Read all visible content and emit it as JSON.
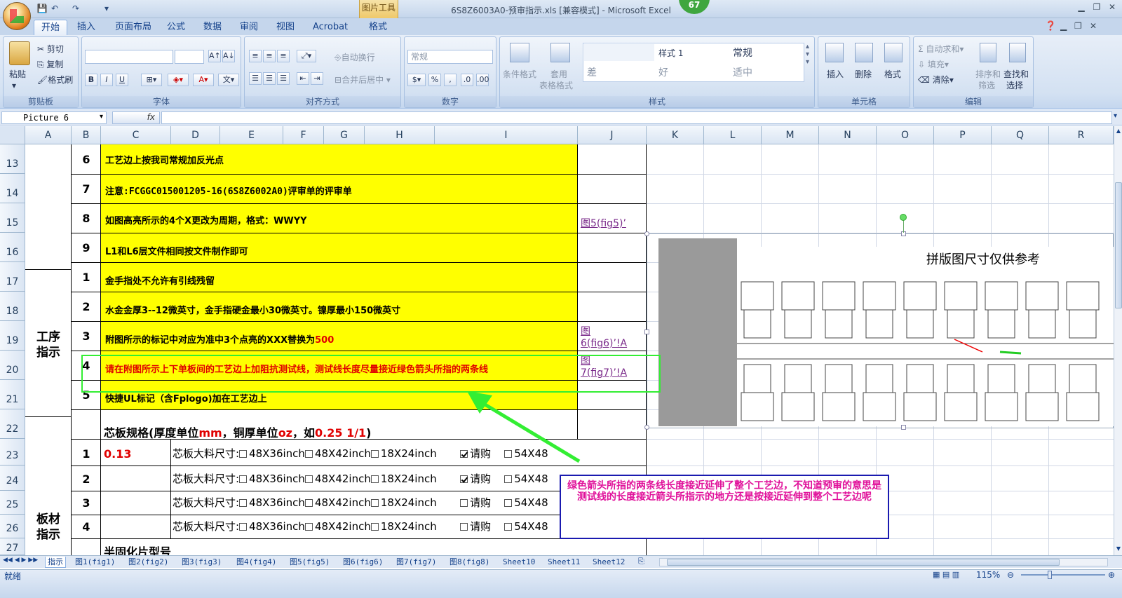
{
  "window": {
    "title": "6S8Z6003A0-预审指示.xls  [兼容模式] - Microsoft Excel",
    "context_tab": "图片工具",
    "badge": "67"
  },
  "tabs": [
    "开始",
    "插入",
    "页面布局",
    "公式",
    "数据",
    "审阅",
    "视图",
    "Acrobat",
    "格式"
  ],
  "ribbon": {
    "clipboard": {
      "label": "剪贴板",
      "paste": "粘贴",
      "cut": "剪切",
      "copy": "复制",
      "format_painter": "格式刷"
    },
    "font": {
      "label": "字体",
      "bold": "B",
      "italic": "I",
      "underline": "U"
    },
    "alignment": {
      "label": "对齐方式",
      "wrap": "自动换行",
      "merge": "合并后居中"
    },
    "number": {
      "label": "数字",
      "format": "常规",
      "percent": "%"
    },
    "styles": {
      "label": "样式",
      "conditional": "条件格式",
      "table_format_1": "套用",
      "table_format_2": "表格格式",
      "style1": "样式 1",
      "normal": "常规",
      "bad": "差",
      "good": "好",
      "neutral": "适中"
    },
    "cells": {
      "label": "单元格",
      "insert": "插入",
      "delete": "删除",
      "format": "格式"
    },
    "editing": {
      "label": "编辑",
      "autosum": "自动求和",
      "fill": "填充",
      "clear": "清除",
      "sort_1": "排序和",
      "sort_2": "筛选",
      "find_1": "查找和",
      "find_2": "选择"
    }
  },
  "formula_bar": {
    "name_box": "Picture 6",
    "fx": "fx",
    "value": ""
  },
  "columns": [
    "A",
    "B",
    "C",
    "D",
    "E",
    "F",
    "G",
    "H",
    "I",
    "J",
    "K",
    "L",
    "M",
    "N",
    "O",
    "P",
    "Q",
    "R"
  ],
  "rows": [
    {
      "num": "13",
      "idx": "6",
      "text": "工艺边上按我司常规加反光点",
      "link": ""
    },
    {
      "num": "14",
      "idx": "7",
      "text": "注意:FCGGC015001205-16(6S8Z6002A0)评审单的评审单",
      "link": ""
    },
    {
      "num": "15",
      "idx": "8",
      "text": "如图高亮所示的4个X更改为周期，格式：WWYY",
      "link": "图5(fig5)’"
    },
    {
      "num": "16",
      "idx": "9",
      "text": "L1和L6层文件相同按文件制作即可",
      "link": ""
    },
    {
      "num": "17",
      "idx": "1",
      "text": "金手指处不允许有引线残留",
      "link": ""
    },
    {
      "num": "18",
      "idx": "2",
      "text": "水金金厚3--12微英寸，金手指硬金最小30微英寸。镍厚最小150微英寸",
      "link": ""
    },
    {
      "num": "19",
      "idx": "3",
      "text": "附图所示的标记中对应为准中3个点亮的XXX替换为",
      "text_red": "500",
      "link1": "图",
      "link2": "6(fig6)’!A"
    },
    {
      "num": "20",
      "idx": "4",
      "text_red": "请在附图所示上下单板间的工艺边上加阻抗测试线，测试线长度尽量接近绿色箭头所指的两条线",
      "link1": "图",
      "link2": "7(fig7)’!A"
    },
    {
      "num": "21",
      "idx": "5",
      "text": "快捷UL标记（含Fplogo)加在工艺边上",
      "link": ""
    }
  ],
  "section_labels": {
    "gongxu_1": "工序",
    "gongxu_2": "指示",
    "bancai_1": "板材",
    "bancai_2": "指示"
  },
  "core_spec": {
    "header_a": "芯板规格(厚度单位",
    "header_mm": "mm",
    "header_b": "，铜厚单位",
    "header_oz": "oz",
    "header_c": "，如",
    "header_d": "0.25 1/1",
    "header_e": ")",
    "row_label": "芯板大料尺寸:",
    "options": [
      "48X36inch",
      "48X42inch",
      "18X24inch"
    ],
    "purchase": "请购",
    "extra": "54X48",
    "rows": [
      {
        "num": "22"
      },
      {
        "num": "23",
        "idx": "1",
        "thickness": "0.13",
        "purchase_checked": true
      },
      {
        "num": "24",
        "idx": "2",
        "thickness": "",
        "purchase_checked": true
      },
      {
        "num": "25",
        "idx": "3",
        "thickness": "",
        "purchase_checked": false
      },
      {
        "num": "26",
        "idx": "4",
        "thickness": "",
        "purchase_checked": false
      },
      {
        "num": "27",
        "text": "半固化片型号"
      }
    ]
  },
  "picture": {
    "title": "拼版图尺寸仅供参考"
  },
  "comment": {
    "text": "绿色箭头所指的两条线长度接近延伸了整个工艺边，不知道预审的意思是测试线的长度接近箭头所指示的地方还是按接近延伸到整个工艺边呢"
  },
  "sheets": [
    "指示",
    "图1(fig1)",
    "图2(fig2)",
    "图3(fig3)",
    "图4(fig4)",
    "图5(fig5)",
    "图6(fig6)",
    "图7(fig7)",
    "图8(fig8)",
    "Sheet10",
    "Sheet11",
    "Sheet12"
  ],
  "status": {
    "ready": "就绪",
    "zoom": "115%"
  },
  "colors": {
    "yellow": "#ffff00",
    "green_arrow": "#33ee33",
    "comment_border": "#1a1ab0",
    "comment_text": "#e0109a"
  }
}
